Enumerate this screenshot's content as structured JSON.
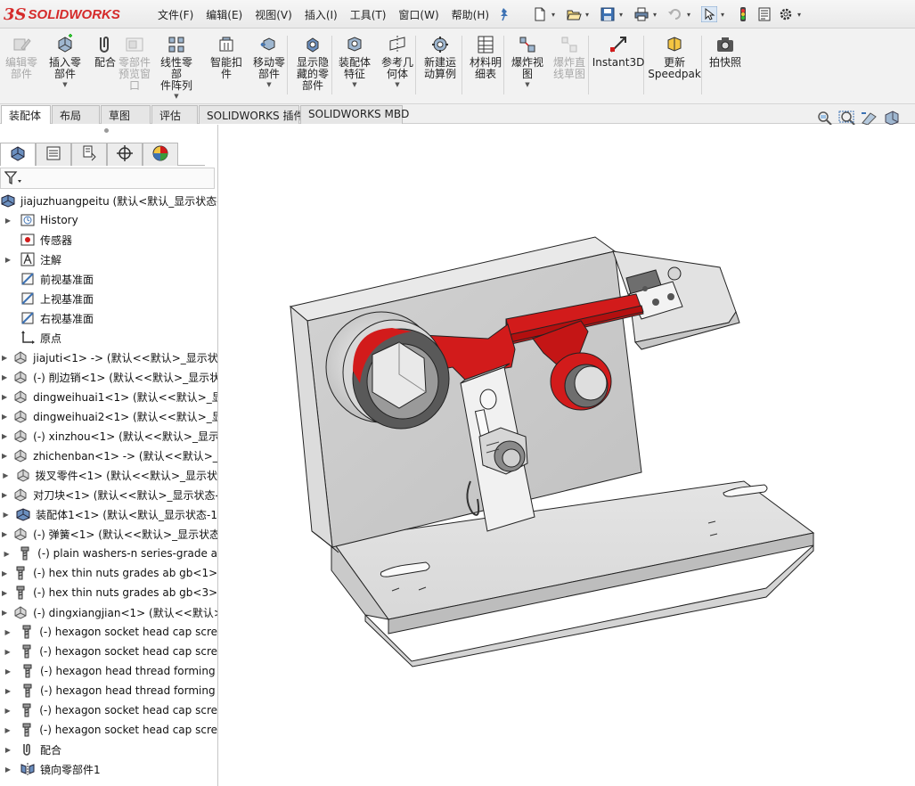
{
  "app": {
    "logo_ds": "3S",
    "logo_name": "SOLIDWORKS"
  },
  "menu": [
    "文件(F)",
    "编辑(E)",
    "视图(V)",
    "插入(I)",
    "工具(T)",
    "窗口(W)",
    "帮助(H)"
  ],
  "quick_icons": [
    "new-document-icon",
    "open-icon",
    "save-icon",
    "print-icon",
    "undo-icon",
    "select-arrow-icon",
    "traffic-light-icon",
    "file-properties-icon",
    "gear-icon"
  ],
  "ribbon": {
    "buttons": [
      {
        "label": "编辑零\n部件",
        "icon": "edit-component-icon",
        "enabled": false,
        "dropdown": false
      },
      {
        "label": "插入零\n部件",
        "icon": "insert-component-icon",
        "enabled": true,
        "dropdown": true
      },
      {
        "label": "配合",
        "icon": "mate-icon",
        "enabled": true,
        "dropdown": false
      },
      {
        "label": "零部件\n预览窗\n口",
        "icon": "component-preview-icon",
        "enabled": false,
        "dropdown": false
      },
      {
        "label": "线性零部\n件阵列",
        "icon": "linear-pattern-icon",
        "enabled": true,
        "dropdown": true
      },
      {
        "label": "智能扣\n件",
        "icon": "smart-fasteners-icon",
        "enabled": true,
        "dropdown": false
      },
      {
        "label": "移动零\n部件",
        "icon": "move-component-icon",
        "enabled": true,
        "dropdown": true
      },
      {
        "label": "显示隐\n藏的零\n部件",
        "icon": "show-hidden-icon",
        "enabled": true,
        "dropdown": false
      },
      {
        "label": "装配体\n特征",
        "icon": "assembly-features-icon",
        "enabled": true,
        "dropdown": true
      },
      {
        "label": "参考几\n何体",
        "icon": "reference-geometry-icon",
        "enabled": true,
        "dropdown": true
      },
      {
        "label": "新建运\n动算例",
        "icon": "new-motion-study-icon",
        "enabled": true,
        "dropdown": false
      },
      {
        "label": "材料明\n细表",
        "icon": "bom-icon",
        "enabled": true,
        "dropdown": false
      },
      {
        "label": "爆炸视\n图",
        "icon": "exploded-view-icon",
        "enabled": true,
        "dropdown": true
      },
      {
        "label": "爆炸直\n线草图",
        "icon": "explode-line-sketch-icon",
        "enabled": false,
        "dropdown": false
      },
      {
        "label": "Instant3D",
        "icon": "instant3d-icon",
        "enabled": true,
        "dropdown": false
      },
      {
        "label": "更新\nSpeedpak",
        "icon": "speedpak-icon",
        "enabled": true,
        "dropdown": false
      },
      {
        "label": "拍快照",
        "icon": "snapshot-icon",
        "enabled": true,
        "dropdown": false
      }
    ]
  },
  "tabs": [
    "装配体",
    "布局",
    "草图",
    "评估",
    "SOLIDWORKS 插件",
    "SOLIDWORKS MBD"
  ],
  "active_tab": 0,
  "panel_tabs": [
    "feature-manager-icon",
    "property-manager-icon",
    "configuration-manager-icon",
    "dimxpert-manager-icon",
    "display-manager-icon"
  ],
  "tree": [
    {
      "label": "jiajuzhuangpeitu  (默认<默认_显示状态-",
      "icon": "assembly-icon",
      "expand": false,
      "root": true
    },
    {
      "label": "History",
      "icon": "history-icon",
      "expand": true
    },
    {
      "label": "传感器",
      "icon": "sensor-icon",
      "expand": false
    },
    {
      "label": "注解",
      "icon": "annotation-icon",
      "expand": true
    },
    {
      "label": "前视基准面",
      "icon": "plane-icon",
      "expand": false
    },
    {
      "label": "上视基准面",
      "icon": "plane-icon",
      "expand": false
    },
    {
      "label": "右视基准面",
      "icon": "plane-icon",
      "expand": false
    },
    {
      "label": "原点",
      "icon": "origin-icon",
      "expand": false
    },
    {
      "label": "jiajuti<1> -> (默认<<默认>_显示状",
      "icon": "part-icon",
      "expand": true
    },
    {
      "label": "(-) 削边销<1> (默认<<默认>_显示状",
      "icon": "part-icon",
      "expand": true
    },
    {
      "label": "dingweihuai1<1> (默认<<默认>_显",
      "icon": "part-icon",
      "expand": true
    },
    {
      "label": "dingweihuai2<1> (默认<<默认>_显",
      "icon": "part-icon",
      "expand": true
    },
    {
      "label": "(-) xinzhou<1> (默认<<默认>_显示",
      "icon": "part-icon",
      "expand": true
    },
    {
      "label": "zhichenban<1> -> (默认<<默认>_",
      "icon": "part-icon",
      "expand": true
    },
    {
      "label": "拨叉零件<1> (默认<<默认>_显示状",
      "icon": "part-icon",
      "expand": true
    },
    {
      "label": "对刀块<1> (默认<<默认>_显示状态-",
      "icon": "part-icon",
      "expand": true
    },
    {
      "label": "装配体1<1> (默认<默认_显示状态-1",
      "icon": "subassembly-icon",
      "expand": true
    },
    {
      "label": "(-) 弹簧<1> (默认<<默认>_显示状态",
      "icon": "part-icon",
      "expand": true
    },
    {
      "label": "(-) plain washers-n series-grade a",
      "icon": "fastener-icon",
      "expand": true
    },
    {
      "label": "(-) hex thin nuts grades ab gb<1>",
      "icon": "fastener-icon",
      "expand": true
    },
    {
      "label": "(-) hex thin nuts grades ab gb<3>",
      "icon": "fastener-icon",
      "expand": true
    },
    {
      "label": "(-) dingxiangjian<1> (默认<<默认>_",
      "icon": "part-icon",
      "expand": true
    },
    {
      "label": "(-) hexagon socket head cap scre",
      "icon": "fastener-icon",
      "expand": true
    },
    {
      "label": "(-) hexagon socket head cap scre",
      "icon": "fastener-icon",
      "expand": true
    },
    {
      "label": "(-) hexagon head thread forming",
      "icon": "fastener-icon",
      "expand": true
    },
    {
      "label": "(-) hexagon head thread forming",
      "icon": "fastener-icon",
      "expand": true
    },
    {
      "label": "(-) hexagon socket head cap scre",
      "icon": "fastener-icon",
      "expand": true
    },
    {
      "label": "(-) hexagon socket head cap scre",
      "icon": "fastener-icon",
      "expand": true
    },
    {
      "label": "配合",
      "icon": "mates-folder-icon",
      "expand": true
    },
    {
      "label": "镜向零部件1",
      "icon": "mirror-component-icon",
      "expand": true
    }
  ],
  "colors": {
    "model_gray": "#c8c8c8",
    "model_dark": "#8a8a8a",
    "fork_red": "#d21b1b",
    "accent_blue": "#3d72b4"
  }
}
